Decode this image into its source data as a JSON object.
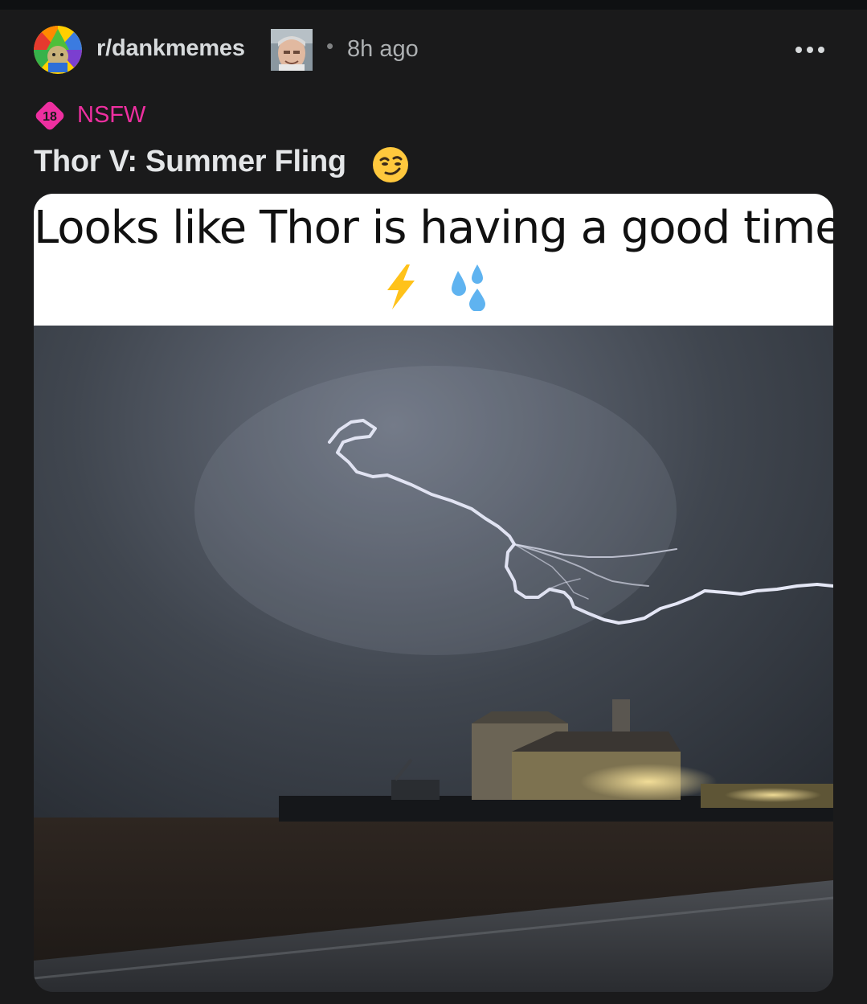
{
  "post": {
    "subreddit": "r/dankmemes",
    "separator": "•",
    "time_ago": "8h ago",
    "nsfw_badge_text": "18",
    "nsfw_label": "NSFW",
    "title": "Thor V: Summer Fling",
    "title_emoji": "smirking-face",
    "meme_caption": "Looks like Thor is having a good time",
    "caption_emojis": [
      "lightning-bolt",
      "sweat-droplets"
    ]
  },
  "icons": {
    "more": "more-options-icon",
    "subreddit_avatar": "subreddit-avatar",
    "user_avatar": "user-avatar"
  },
  "colors": {
    "background": "#1a1a1b",
    "nsfw": "#ee2fa0",
    "text": "#d7dadc",
    "muted": "#adb0b2"
  }
}
